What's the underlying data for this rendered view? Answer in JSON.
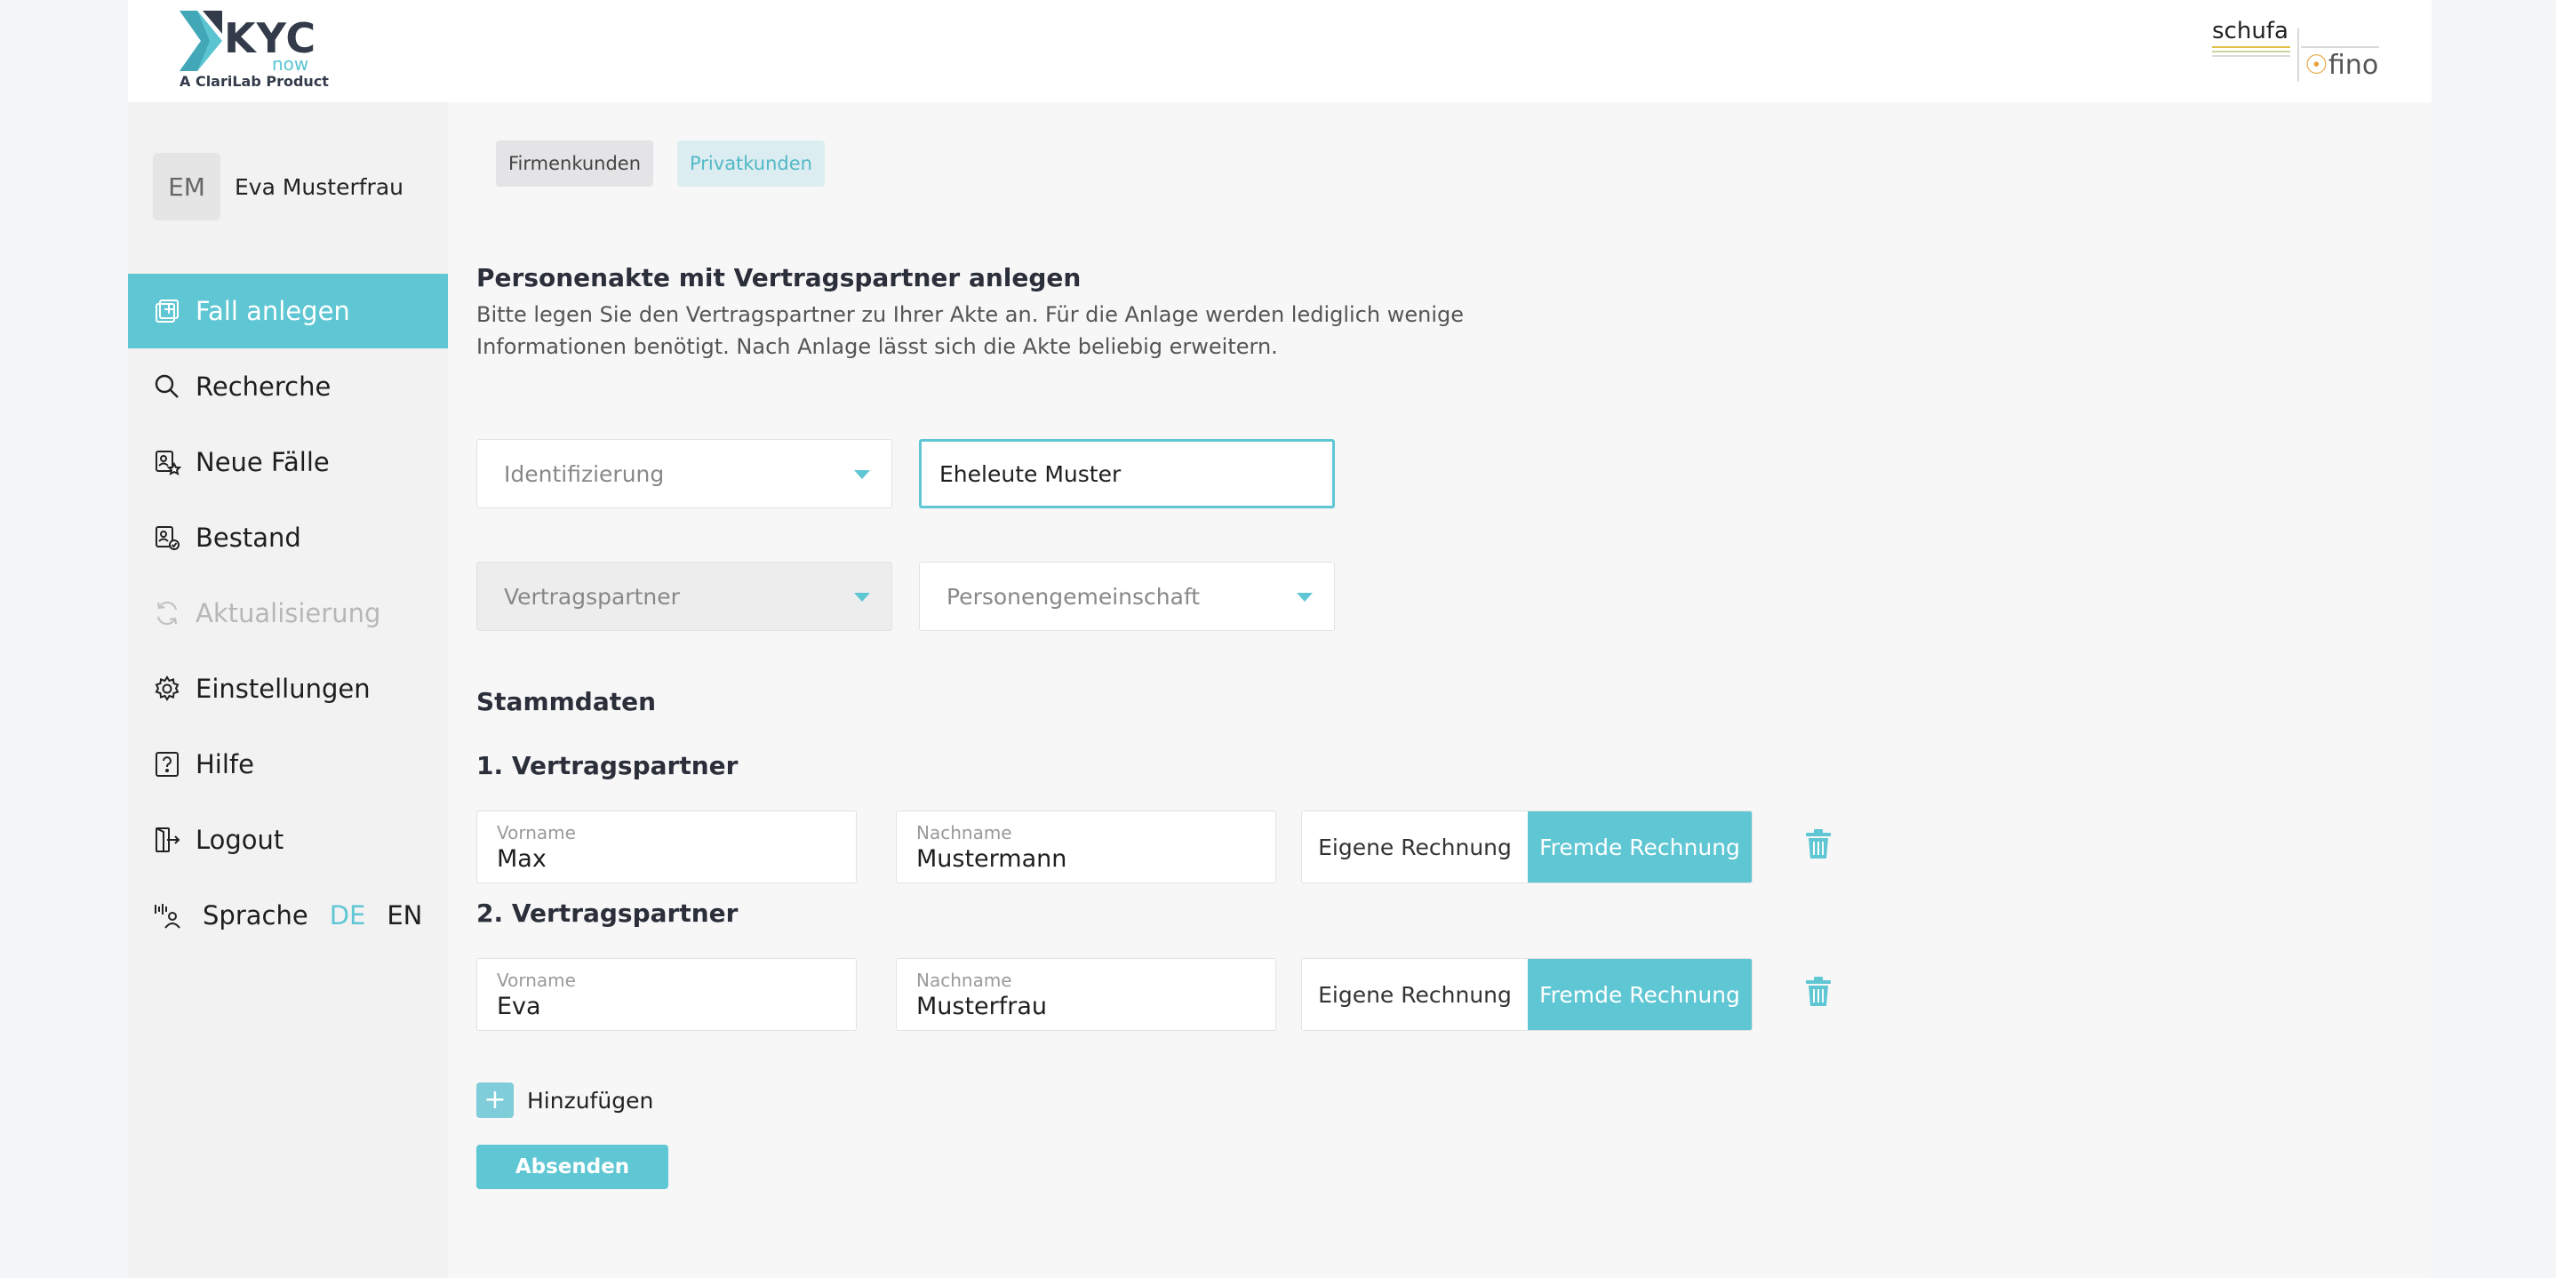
{
  "brand": {
    "logo_text": "KYC",
    "logo_sub_text": "now",
    "tagline": "A ClariLab Product",
    "partner_primary": "schufa",
    "partner_secondary": "fino",
    "accent": "#5fc6d3"
  },
  "user": {
    "initials": "EM",
    "name": "Eva Musterfrau"
  },
  "nav": {
    "items": [
      {
        "label": "Fall anlegen",
        "icon": "add-case-icon",
        "state": "active"
      },
      {
        "label": "Recherche",
        "icon": "search-icon",
        "state": "normal"
      },
      {
        "label": "Neue Fälle",
        "icon": "new-cases-icon",
        "state": "normal"
      },
      {
        "label": "Bestand",
        "icon": "portfolio-icon",
        "state": "normal"
      },
      {
        "label": "Aktualisierung",
        "icon": "refresh-icon",
        "state": "disabled"
      },
      {
        "label": "Einstellungen",
        "icon": "gear-icon",
        "state": "normal"
      },
      {
        "label": "Hilfe",
        "icon": "help-icon",
        "state": "normal"
      },
      {
        "label": "Logout",
        "icon": "logout-icon",
        "state": "normal"
      }
    ],
    "language": {
      "label": "Sprache",
      "de": "DE",
      "en": "EN",
      "selected": "DE"
    }
  },
  "tabs": {
    "firm": "Firmenkunden",
    "private": "Privatkunden",
    "selected": "Privatkunden"
  },
  "form": {
    "title": "Personenakte mit Vertragspartner anlegen",
    "intro": "Bitte legen Sie den Vertragspartner zu Ihrer Akte an. Für die Anlage werden lediglich wenige Informationen benötigt. Nach Anlage lässt sich die Akte beliebig erweitern.",
    "identification_placeholder": "Identifizierung",
    "case_name_value": "Eheleute Muster",
    "partner_type_placeholder": "Vertragspartner",
    "partner_kind_value": "Personengemeinschaft",
    "master_data_title": "Stammdaten",
    "partners": [
      {
        "heading": "1. Vertragspartner",
        "first_name_label": "Vorname",
        "first_name": "Max",
        "last_name_label": "Nachname",
        "last_name": "Mustermann",
        "own_account": "Eigene Rechnung",
        "foreign_account": "Fremde Rechnung",
        "selected": "Fremde Rechnung"
      },
      {
        "heading": "2. Vertragspartner",
        "first_name_label": "Vorname",
        "first_name": "Eva",
        "last_name_label": "Nachname",
        "last_name": "Musterfrau",
        "own_account": "Eigene Rechnung",
        "foreign_account": "Fremde Rechnung",
        "selected": "Fremde Rechnung"
      }
    ],
    "add_label": "Hinzufügen",
    "add_symbol": "+",
    "submit_label": "Absenden"
  }
}
